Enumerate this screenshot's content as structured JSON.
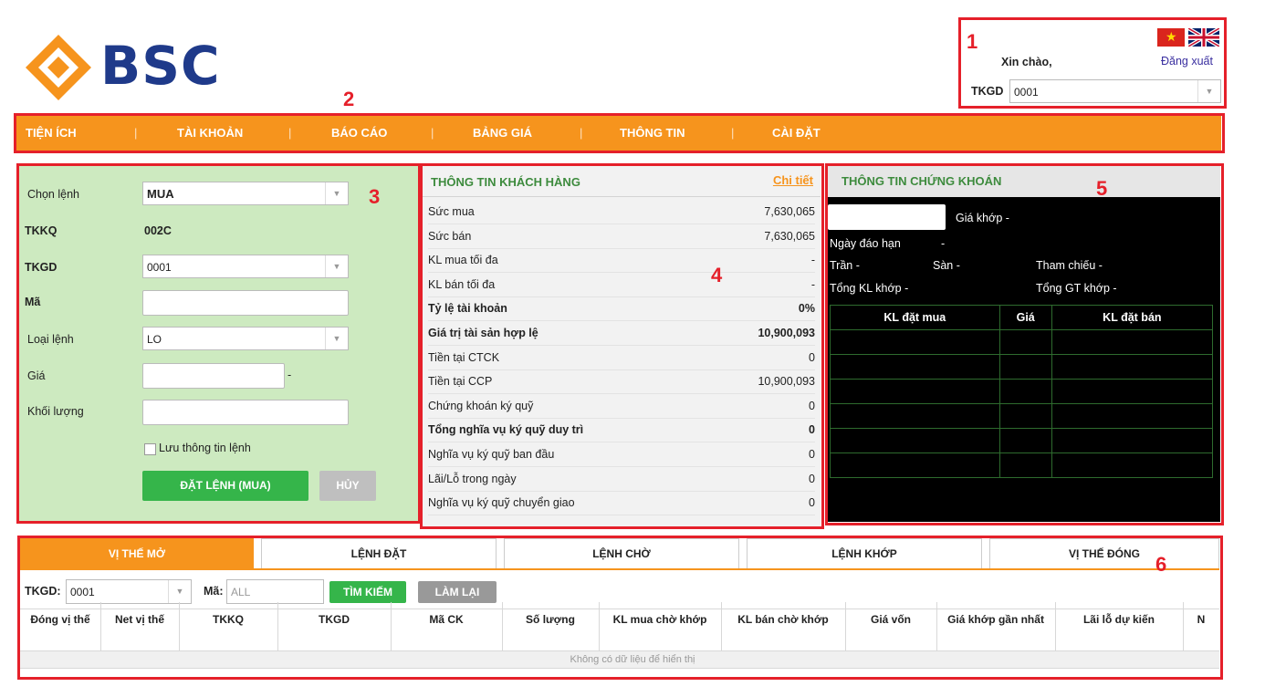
{
  "header": {
    "brand": "BSC",
    "greeting": "Xin chào,",
    "logout": "Đăng xuất",
    "tkgd_label": "TKGD",
    "tkgd_value": "0001"
  },
  "callouts": [
    "1",
    "2",
    "3",
    "4",
    "5",
    "6"
  ],
  "nav": {
    "items": [
      "TIỆN ÍCH",
      "TÀI KHOẢN",
      "BÁO CÁO",
      "BẢNG GIÁ",
      "THÔNG TIN",
      "CÀI ĐẶT"
    ],
    "separator": "|"
  },
  "order": {
    "chon_lenh_label": "Chọn lệnh",
    "chon_lenh_value": "MUA",
    "tkkq_label": "TKKQ",
    "tkkq_value": "002C",
    "tkgd_label": "TKGD",
    "tkgd_value": "0001",
    "ma_label": "Mã",
    "loai_lenh_label": "Loại lệnh",
    "loai_lenh_value": "LO",
    "gia_label": "Giá",
    "gia_suffix": "-",
    "khoi_luong_label": "Khối lượng",
    "save_label": "Lưu thông tin lệnh",
    "submit_label": "ĐẶT LỆNH (MUA)",
    "cancel_label": "HỦY"
  },
  "info": {
    "title": "THÔNG TIN KHÁCH HÀNG",
    "detail_link": "Chi tiết",
    "rows": [
      {
        "k": "Sức mua",
        "v": "7,630,065",
        "bold": false
      },
      {
        "k": "Sức bán",
        "v": "7,630,065",
        "bold": false
      },
      {
        "k": "KL mua tối đa",
        "v": "-",
        "bold": false
      },
      {
        "k": "KL bán tối đa",
        "v": "-",
        "bold": false
      },
      {
        "k": "Tỷ lệ tài khoản",
        "v": "0%",
        "bold": true
      },
      {
        "k": "Giá trị tài sản hợp lệ",
        "v": "10,900,093",
        "bold": true
      },
      {
        "k": "Tiền tại CTCK",
        "v": "0",
        "bold": false
      },
      {
        "k": "Tiền tại CCP",
        "v": "10,900,093",
        "bold": false
      },
      {
        "k": "Chứng khoán ký quỹ",
        "v": "0",
        "bold": false
      },
      {
        "k": "Tổng nghĩa vụ ký quỹ duy trì",
        "v": "0",
        "bold": true
      },
      {
        "k": "Nghĩa vụ ký quỹ ban đầu",
        "v": "0",
        "bold": false
      },
      {
        "k": "Lãi/Lỗ trong ngày",
        "v": "0",
        "bold": false
      },
      {
        "k": "Nghĩa vụ ký quỹ chuyển giao",
        "v": "0",
        "bold": false
      }
    ]
  },
  "security": {
    "title": "THÔNG TIN CHỨNG KHOÁN",
    "gia_khop": "Giá khớp -",
    "ngay_dao_han": "Ngày đáo hạn",
    "ngay_dao_han_val": "-",
    "tran": "Trần -",
    "san": "Sàn -",
    "tham_chieu": "Tham chiếu -",
    "tong_kl": "Tổng KL khớp -",
    "tong_gt": "Tổng GT khớp -",
    "orderbook_headers": [
      "KL đặt mua",
      "Giá",
      "KL đặt bán"
    ]
  },
  "bottom": {
    "tabs": [
      "VỊ THẾ MỞ",
      "LỆNH ĐẶT",
      "LỆNH CHỜ",
      "LỆNH KHỚP",
      "VỊ THẾ ĐÓNG"
    ],
    "tkgd_label": "TKGD:",
    "tkgd_value": "0001",
    "ma_label": "Mã:",
    "ma_placeholder": "ALL",
    "search_label": "TÌM KIẾM",
    "reset_label": "LÀM LẠI",
    "columns": [
      "Đóng vị thế",
      "Net vị thế",
      "TKKQ",
      "TKGD",
      "Mã CK",
      "Số lượng",
      "KL mua chờ khớp",
      "KL bán chờ khớp",
      "Giá vốn",
      "Giá khớp gần nhất",
      "Lãi lỗ dự kiến",
      "N"
    ],
    "empty_text": "Không có dữ liệu để hiển thị"
  },
  "colors": {
    "accent": "#f6941d",
    "brand": "#1f3a8a",
    "callout": "#e5202a",
    "green": "#35b54a"
  }
}
